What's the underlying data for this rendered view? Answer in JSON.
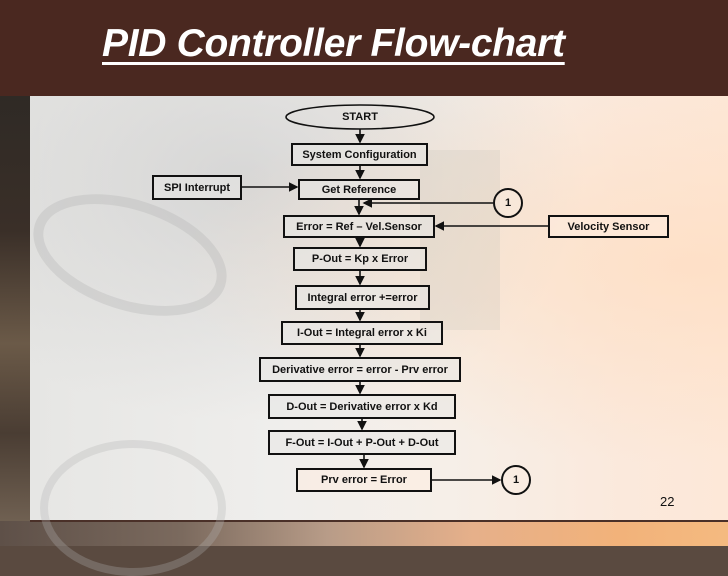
{
  "slide": {
    "title": "PID Controller Flow-chart",
    "page_number": "22"
  },
  "flowchart": {
    "start": "START",
    "steps": [
      "System Configuration",
      "Get Reference",
      "Error = Ref – Vel.Sensor",
      "P-Out = Kp x Error",
      "Integral error +=error",
      "I-Out = Integral error x Ki",
      "Derivative error = error - Prv error",
      "D-Out = Derivative error x Kd",
      "F-Out = I-Out + P-Out  + D-Out",
      "Prv error = Error"
    ],
    "inputs": {
      "spi_interrupt": "SPI Interrupt",
      "velocity_sensor": "Velocity Sensor"
    },
    "connectors": {
      "loop_top": "1",
      "loop_bottom": "1"
    },
    "colors": {
      "header": "#4a2820",
      "line": "#111111",
      "title_text": "#ffffff"
    }
  }
}
